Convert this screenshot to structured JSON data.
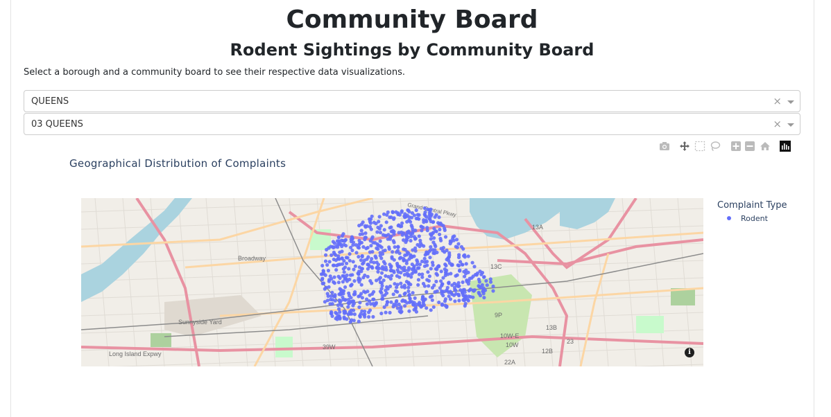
{
  "page": {
    "title": "Community Board",
    "subtitle": "Rodent Sightings by Community Board",
    "instructions": "Select a borough and a community board to see their respective data visualizations."
  },
  "filters": {
    "borough": {
      "value": "QUEENS",
      "clear_icon": "clear-x-icon",
      "arrow_icon": "caret-down-icon"
    },
    "community_board": {
      "value": "03 QUEENS",
      "clear_icon": "clear-x-icon",
      "arrow_icon": "caret-down-icon"
    }
  },
  "modebar": {
    "buttons": [
      "camera-icon",
      "pan-icon",
      "box-select-icon",
      "lasso-icon",
      "zoom-in-icon",
      "zoom-out-icon",
      "home-icon",
      "plotly-logo-icon"
    ]
  },
  "chart": {
    "title": "Geographical Distribution of Complaints",
    "legend_title": "Complaint Type",
    "legend_items": [
      {
        "label": "Rodent",
        "color": "#636efa"
      }
    ],
    "info_symbol": "i"
  },
  "chart_data": {
    "type": "scatter",
    "title": "Geographical Distribution of Complaints",
    "series": [
      {
        "name": "Rodent",
        "color": "#636efa"
      }
    ],
    "legend_placement": "right",
    "basemap": "openstreetmap"
  },
  "map_labels": [
    "Grand Central Pkwy",
    "Sunnyside Yard",
    "Long Island Expwy",
    "Broadway",
    "39W",
    "13A",
    "13B",
    "13C",
    "9W",
    "9P",
    "10W-E",
    "10W",
    "22A",
    "12B",
    "12",
    "13",
    "23"
  ]
}
